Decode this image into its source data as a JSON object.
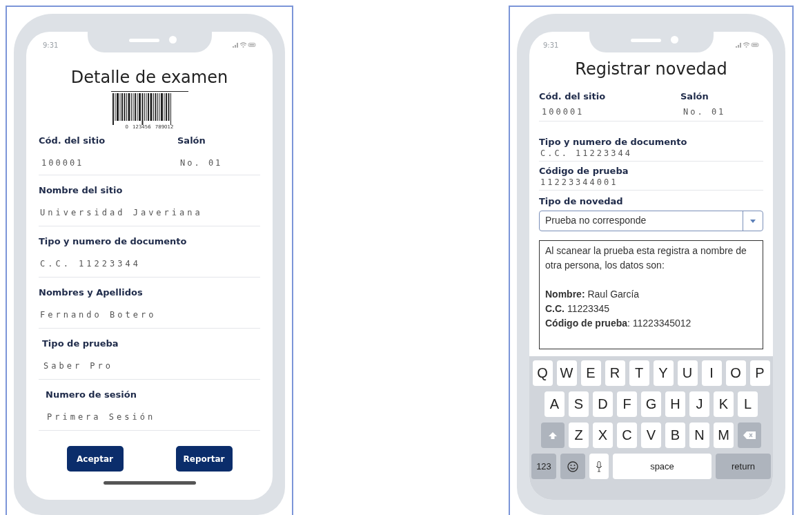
{
  "left_phone": {
    "status_time": "9:31",
    "title": "Detalle de examen",
    "barcode_digits": [
      "0",
      "123456",
      "789012"
    ],
    "pair": [
      {
        "label": "Cód. del sitio",
        "value": "100001"
      },
      {
        "label": "Salón",
        "value": "No. 01"
      }
    ],
    "fields": [
      {
        "label": "Nombre del sitio",
        "value": "Universidad Javeriana"
      },
      {
        "label": "Tipo y numero de documento",
        "value": "C.C. 11223344"
      },
      {
        "label": "Nombres y Apellidos",
        "value": "Fernando Botero"
      },
      {
        "label": "Tipo de prueba",
        "value": "Saber Pro"
      },
      {
        "label": "Numero de sesión",
        "value": "Primera Sesión"
      }
    ],
    "buttons": [
      "Aceptar",
      "Reportar"
    ]
  },
  "right_phone": {
    "status_time": "9:31",
    "title": "Registrar novedad",
    "pair": [
      {
        "label": "Cód. del sitio",
        "value": "100001"
      },
      {
        "label": "Salón",
        "value": "No. 01"
      }
    ],
    "fields": [
      {
        "label": "Tipo y numero de documento",
        "value": "C.C. 11223344"
      },
      {
        "label": "Código de prueba",
        "value": "11223344001"
      }
    ],
    "select": {
      "label": "Tipo de novedad",
      "value": "Prueba no corresponde"
    },
    "note": [
      "Al scanear la prueba esta registra a nombre de otra persona, los datos son:",
      "**Nombre:** Raul García",
      "**C.C.** 11223345",
      "**Código de prueba**: 11223345012"
    ],
    "keyboard": [
      [
        {
          "kind": "letter",
          "label": "Q"
        },
        {
          "kind": "letter",
          "label": "W"
        },
        {
          "kind": "letter",
          "label": "E"
        },
        {
          "kind": "letter",
          "label": "R"
        },
        {
          "kind": "letter",
          "label": "T"
        },
        {
          "kind": "letter",
          "label": "Y"
        },
        {
          "kind": "letter",
          "label": "U"
        },
        {
          "kind": "letter",
          "label": "I"
        },
        {
          "kind": "letter",
          "label": "O"
        },
        {
          "kind": "letter",
          "label": "P"
        }
      ],
      [
        {
          "kind": "letter",
          "label": "A"
        },
        {
          "kind": "letter",
          "label": "S"
        },
        {
          "kind": "letter",
          "label": "D"
        },
        {
          "kind": "letter",
          "label": "F"
        },
        {
          "kind": "letter",
          "label": "G"
        },
        {
          "kind": "letter",
          "label": "H"
        },
        {
          "kind": "letter",
          "label": "J"
        },
        {
          "kind": "letter",
          "label": "K"
        },
        {
          "kind": "letter",
          "label": "L"
        }
      ],
      [
        {
          "kind": "shift"
        },
        {
          "kind": "letter",
          "label": "Z"
        },
        {
          "kind": "letter",
          "label": "X"
        },
        {
          "kind": "letter",
          "label": "C"
        },
        {
          "kind": "letter",
          "label": "V"
        },
        {
          "kind": "letter",
          "label": "B"
        },
        {
          "kind": "letter",
          "label": "N"
        },
        {
          "kind": "letter",
          "label": "M"
        },
        {
          "kind": "backspace"
        }
      ],
      [
        {
          "kind": "numbers",
          "label": "123"
        },
        {
          "kind": "emoji"
        },
        {
          "kind": "mic"
        },
        {
          "kind": "space",
          "label": "space"
        },
        {
          "kind": "return",
          "label": "return"
        }
      ]
    ]
  }
}
